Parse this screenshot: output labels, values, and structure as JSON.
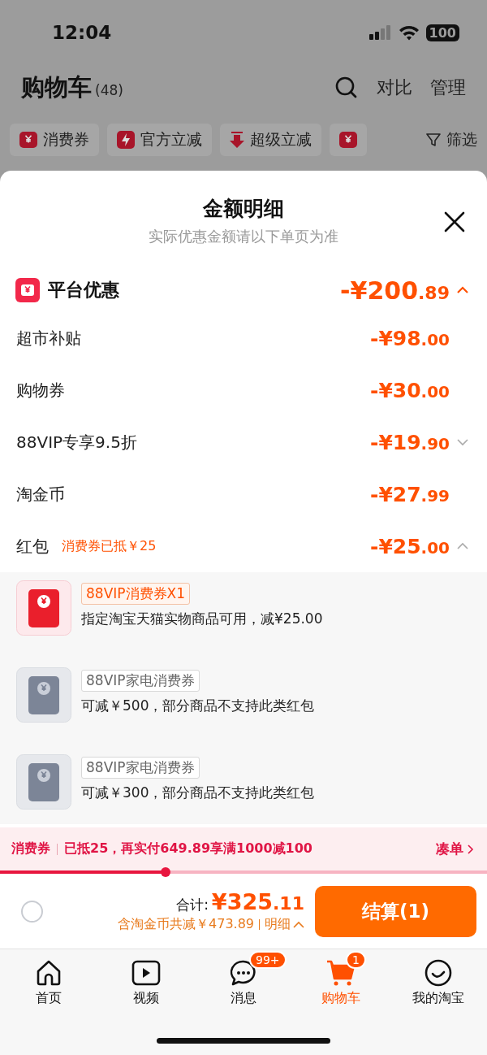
{
  "status_bar": {
    "time": "12:04",
    "battery": "100"
  },
  "header": {
    "title": "购物车",
    "count": "(48)",
    "actions": [
      "对比",
      "管理"
    ]
  },
  "filter_chips": [
    {
      "kind": "coupon",
      "label": "消费券"
    },
    {
      "kind": "bolt",
      "label": "官方立减"
    },
    {
      "kind": "arrow",
      "label": "超级立减"
    },
    {
      "kind": "coupon"
    }
  ],
  "filter_button": "筛选",
  "sheet": {
    "title": "金额明细",
    "subtitle": "实际优惠金额请以下单页为准",
    "summary": {
      "label": "平台优惠",
      "amount": "-¥200",
      "decimals": ".89",
      "expanded": true
    },
    "rows": [
      {
        "label": "超市补贴",
        "amount": "-¥98",
        "decimals": ".00"
      },
      {
        "label": "购物券",
        "amount": "-¥30",
        "decimals": ".00"
      },
      {
        "label": "88VIP专享9.5折",
        "amount": "-¥19",
        "decimals": ".90",
        "expanded": false
      },
      {
        "label": "淘金币",
        "amount": "-¥27",
        "decimals": ".99"
      },
      {
        "label": "红包",
        "note": "消费券已抵￥25",
        "amount": "-¥25",
        "decimals": ".00",
        "expanded": true
      }
    ],
    "coupons": [
      {
        "active": true,
        "tag": "88VIP消费券X1",
        "description": "指定淘宝天猫实物商品可用，减¥25.00"
      },
      {
        "active": false,
        "tag": "88VIP家电消费券",
        "description": "可减￥500，部分商品不支持此类红包"
      },
      {
        "active": false,
        "tag": "88VIP家电消费券",
        "description": "可减￥300，部分商品不支持此类红包"
      }
    ]
  },
  "coupon_bar": {
    "label": "消费券",
    "message": "已抵25，再实付649.89享满1000减100",
    "link": "凑单",
    "level": 0.34
  },
  "checkout": {
    "checked": false,
    "total_label": "合计:",
    "total": "¥325",
    "total_decimals": ".11",
    "saving": "含淘金币共减￥473.89",
    "detail": "明细",
    "button": "结算(1)"
  },
  "tabs": [
    {
      "kind": "home",
      "label": "首页",
      "selected": false
    },
    {
      "kind": "video",
      "label": "视频",
      "selected": false
    },
    {
      "kind": "chat",
      "label": "消息",
      "badge": "99+",
      "selected": false
    },
    {
      "kind": "cart",
      "label": "购物车",
      "badge": "1",
      "selected": true
    },
    {
      "kind": "smile",
      "label": "我的淘宝",
      "selected": false
    }
  ]
}
